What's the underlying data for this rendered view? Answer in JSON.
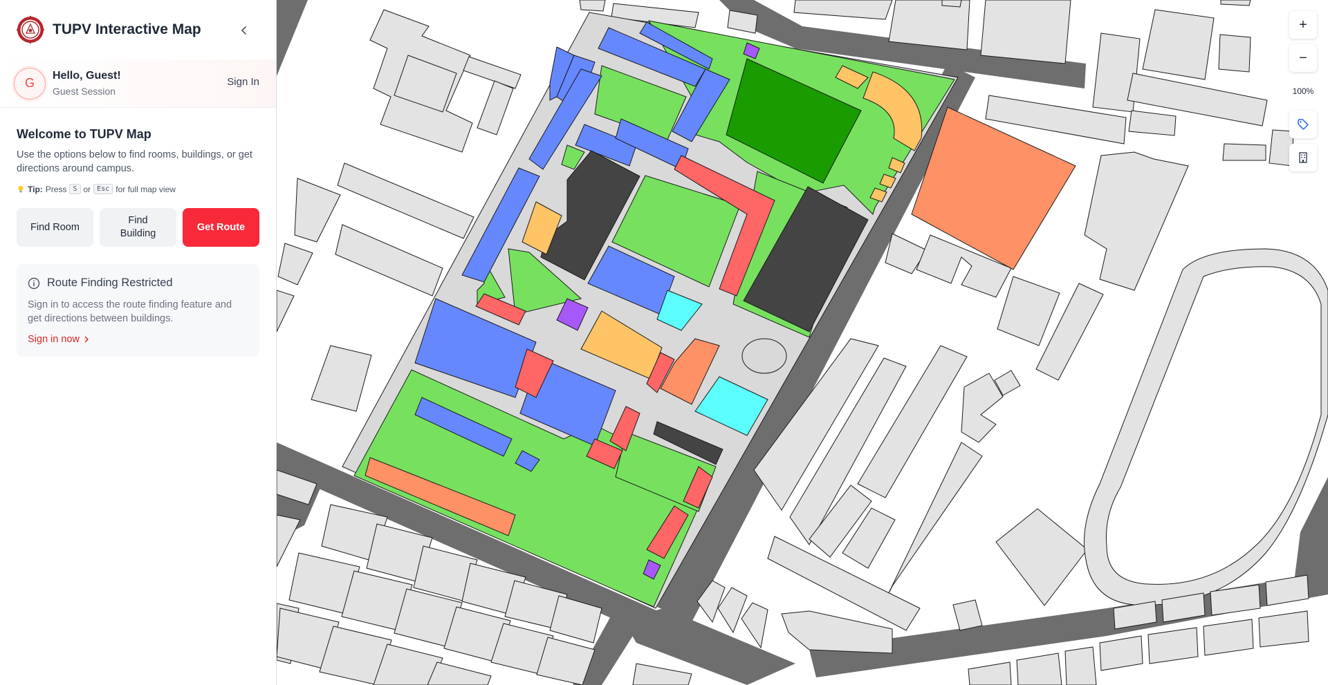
{
  "app": {
    "title": "TUPV Interactive Map"
  },
  "user": {
    "initial": "G",
    "greeting": "Hello, Guest!",
    "session": "Guest Session",
    "sign_in_label": "Sign In"
  },
  "welcome": {
    "title": "Welcome to TUPV Map",
    "description": "Use the options below to find rooms, buildings, or get directions around campus.",
    "tip_label": "Tip:",
    "tip_press": "Press",
    "tip_key1": "S",
    "tip_or": "or",
    "tip_key2": "Esc",
    "tip_suffix": "for full map view"
  },
  "actions": {
    "find_room": "Find Room",
    "find_building": "Find Building",
    "get_route": "Get Route"
  },
  "notice": {
    "title": "Route Finding Restricted",
    "description": "Sign in to access the route finding feature and get directions between buildings.",
    "link": "Sign in now"
  },
  "map_controls": {
    "zoom_in": "+",
    "zoom_out": "−",
    "zoom_level": "100%"
  },
  "icons": {
    "logo": "university-seal-icon",
    "collapse": "chevron-left-icon",
    "tip": "lightbulb-icon",
    "info": "info-circle-icon",
    "link": "chevron-right-icon",
    "labels_toggle": "tag-icon",
    "buildings_toggle": "building-icon"
  },
  "colors": {
    "accent": "#f82a3a",
    "green_area": "#77e15f",
    "dark_green": "#1a9b00",
    "blue_building": "#6688ff",
    "orange_building": "#ff9166",
    "yellow_building": "#ffc466",
    "red_building": "#ff6666",
    "cyan_building": "#5cfdfd",
    "dark_building": "#444444",
    "purple_building": "#a758f8",
    "road": "#6e6e6e"
  }
}
